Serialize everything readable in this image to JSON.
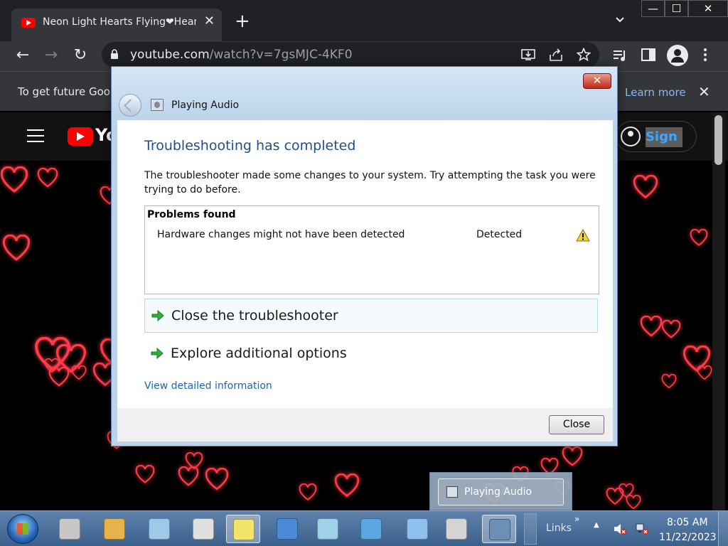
{
  "browser": {
    "tab": {
      "title": "Neon Light Hearts Flying❤Heart",
      "favicon_icon": "youtube-favicon-icon",
      "close_glyph": "✕"
    },
    "new_tab_glyph": "+",
    "window_controls": {
      "minimize": "—",
      "maximize": "☐",
      "close": "✕"
    },
    "toolbar": {
      "back_glyph": "←",
      "forward_glyph": "→",
      "reload_glyph": "↻",
      "url_host": "youtube.com",
      "url_path": "/watch?v=7gsMJC-4KF0",
      "icons": [
        "install-icon",
        "share-icon",
        "bookmark-star-icon",
        "media-control-icon",
        "side-panel-icon",
        "profile-icon",
        "menu-icon"
      ]
    },
    "infobar": {
      "text": "To get future Goog",
      "learn_more": "Learn more",
      "close_glyph": "✕"
    }
  },
  "youtube": {
    "wordmark": "Yo",
    "sign_in": "Sign in"
  },
  "dialog": {
    "title": "Playing Audio",
    "close_x": "✕",
    "heading": "Troubleshooting has completed",
    "description": "The troubleshooter made some changes to your system. Try attempting the task you were trying to do before.",
    "problems": {
      "header": "Problems found",
      "items": [
        {
          "description": "Hardware changes might not have been detected",
          "status": "Detected",
          "status_icon": "warning-icon"
        }
      ]
    },
    "options": [
      {
        "label": "Close the troubleshooter",
        "icon": "green-arrow-icon"
      },
      {
        "label": "Explore additional options",
        "icon": "green-arrow-icon"
      }
    ],
    "view_details": "View detailed information",
    "close_button": "Close"
  },
  "taskbar": {
    "popup_label": "Playing Audio",
    "links_label": "Links",
    "links_chevron": "»",
    "tray_up": "▲",
    "clock_time": "8:05 AM",
    "clock_date": "11/22/2023",
    "pinned_icons": [
      "fax-icon",
      "paint-icon",
      "calculator-icon",
      "snipping-tool-icon",
      "sticky-notes-icon",
      "remote-desktop-icon",
      "documents-icon",
      "network-icon",
      "send-icon",
      "server-icon",
      "troubleshooter-icon"
    ]
  },
  "colors": {
    "chrome_dark": "#202124",
    "dialog_heading": "#1e4f8c",
    "link_blue": "#1e66b4",
    "neon_heart": "#ff3b4a"
  }
}
